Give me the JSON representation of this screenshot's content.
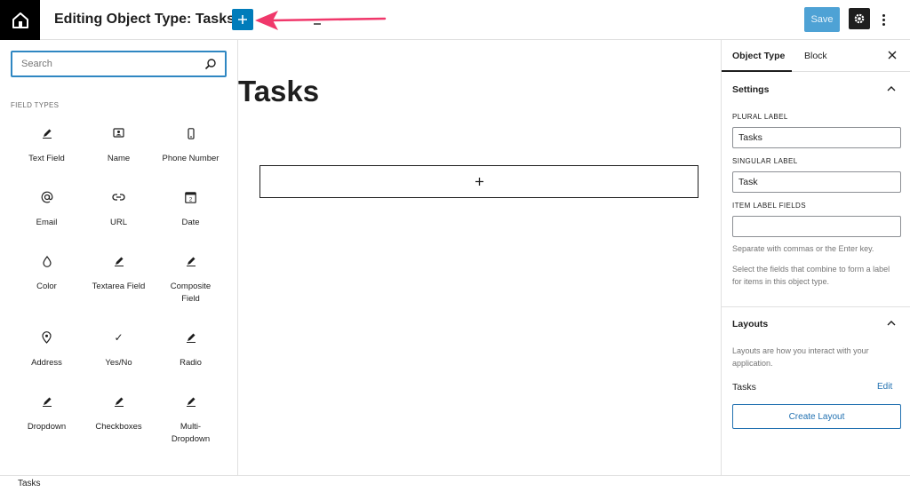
{
  "header": {
    "title": "Editing Object Type: Tasks",
    "save_label": "Save",
    "icons": [
      "home-icon",
      "plus-icon",
      "list-view-icon",
      "gear-icon",
      "more-vertical-icon"
    ],
    "accent_color": "#007cba",
    "annotation_arrow_color": "#f0386b"
  },
  "inserter": {
    "search_placeholder": "Search",
    "section_label": "FIELD TYPES",
    "fields": [
      {
        "label": "Text Field",
        "icon": "pencil-icon"
      },
      {
        "label": "Name",
        "icon": "id-card-icon"
      },
      {
        "label": "Phone Number",
        "icon": "mobile-phone-icon"
      },
      {
        "label": "Email",
        "icon": "at-sign-icon"
      },
      {
        "label": "URL",
        "icon": "link-icon"
      },
      {
        "label": "Date",
        "icon": "calendar-icon",
        "icon_text": "2"
      },
      {
        "label": "Color",
        "icon": "droplet-icon"
      },
      {
        "label": "Textarea Field",
        "icon": "pencil-icon"
      },
      {
        "label": "Composite Field",
        "icon": "pencil-icon"
      },
      {
        "label": "Address",
        "icon": "map-pin-icon"
      },
      {
        "label": "Yes/No",
        "icon": "checkmark-icon",
        "icon_text": "✓"
      },
      {
        "label": "Radio",
        "icon": "pencil-icon"
      },
      {
        "label": "Dropdown",
        "icon": "pencil-icon"
      },
      {
        "label": "Checkboxes",
        "icon": "pencil-icon"
      },
      {
        "label": "Multi-Dropdown",
        "icon": "pencil-icon"
      }
    ]
  },
  "canvas": {
    "title": "Tasks",
    "appender_icon": "plus-icon"
  },
  "sidebar": {
    "tabs": [
      {
        "label": "Object Type",
        "active": true
      },
      {
        "label": "Block",
        "active": false
      }
    ],
    "settings": {
      "heading": "Settings",
      "plural_label": "PLURAL LABEL",
      "plural_value": "Tasks",
      "singular_label": "SINGULAR LABEL",
      "singular_value": "Task",
      "item_label_fields": "ITEM LABEL FIELDS",
      "item_label_value": "",
      "help_1": "Separate with commas or the Enter key.",
      "help_2": "Select the fields that combine to form a label for items in this object type."
    },
    "layouts": {
      "heading": "Layouts",
      "description": "Layouts are how you interact with your application.",
      "items": [
        {
          "name": "Tasks",
          "action": "Edit"
        }
      ],
      "create_label": "Create Layout"
    }
  },
  "footer": {
    "breadcrumb": "Tasks"
  }
}
